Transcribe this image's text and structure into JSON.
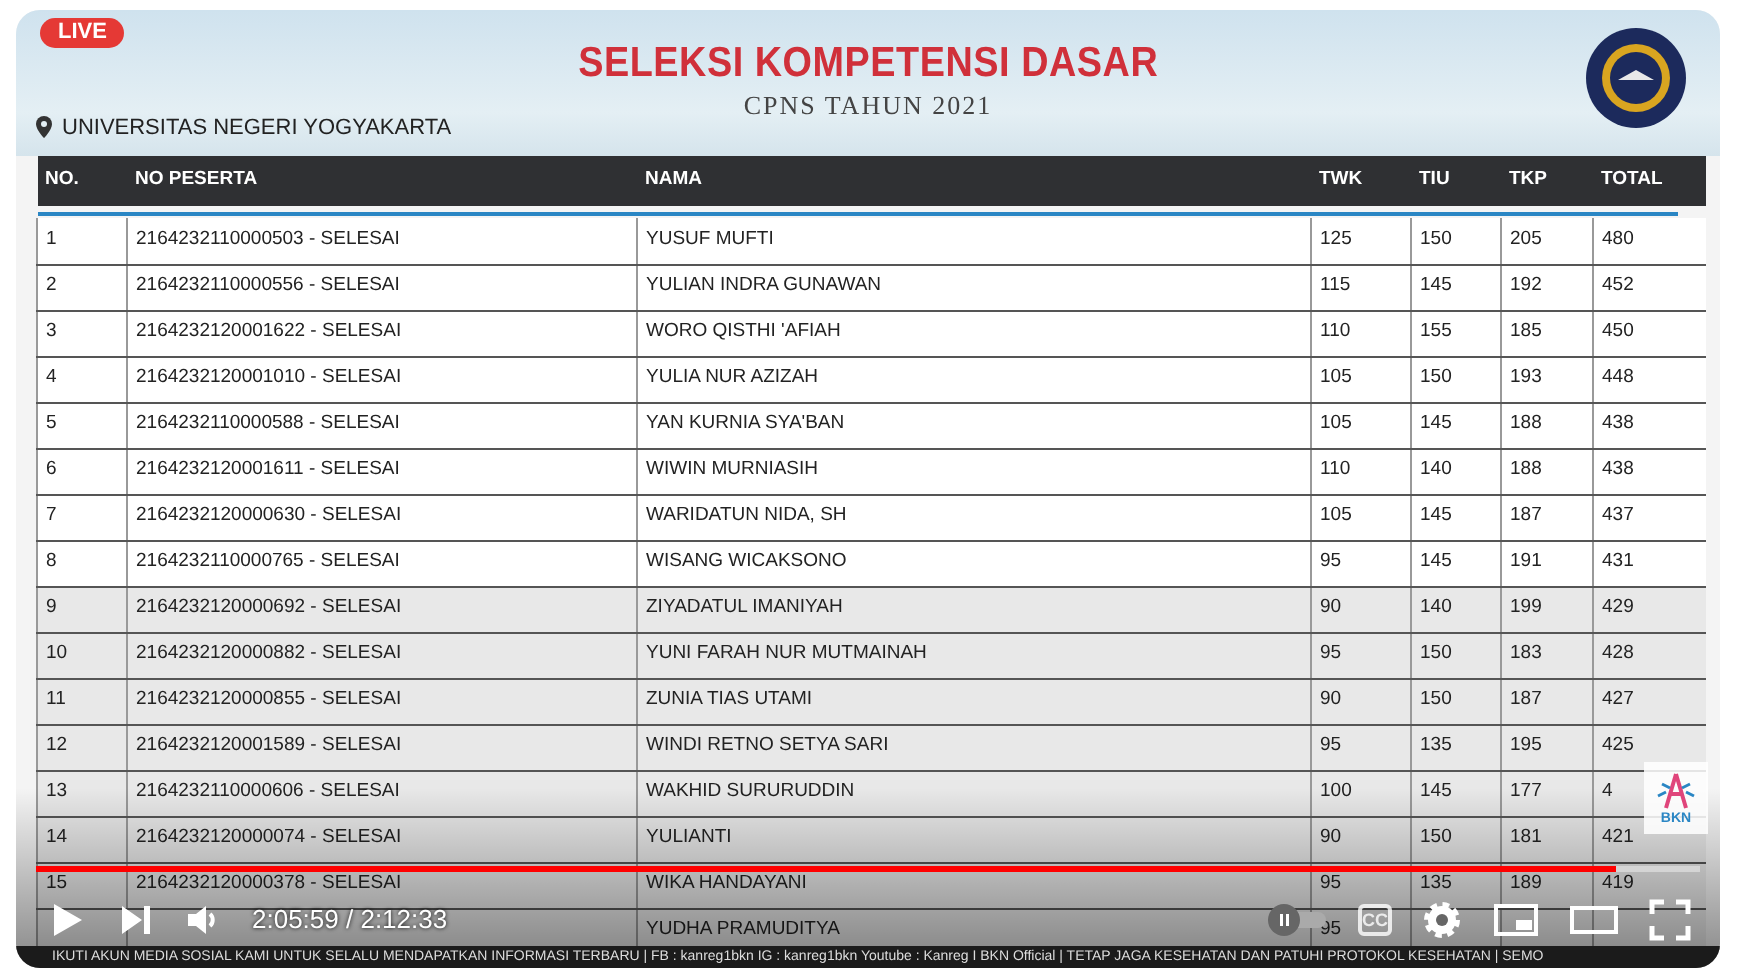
{
  "live_badge": "LIVE",
  "header": {
    "title": "SELEKSI KOMPETENSI DASAR",
    "subtitle": "CPNS TAHUN 2021",
    "location": "UNIVERSITAS NEGERI YOGYAKARTA"
  },
  "table": {
    "columns": [
      "NO.",
      "NO PESERTA",
      "NAMA",
      "TWK",
      "TIU",
      "TKP",
      "TOTAL"
    ],
    "rows": [
      [
        "1",
        "2164232110000503 - SELESAI",
        "YUSUF MUFTI",
        "125",
        "150",
        "205",
        "480"
      ],
      [
        "2",
        "2164232110000556 - SELESAI",
        "YULIAN INDRA GUNAWAN",
        "115",
        "145",
        "192",
        "452"
      ],
      [
        "3",
        "2164232120001622 - SELESAI",
        "WORO QISTHI 'AFIAH",
        "110",
        "155",
        "185",
        "450"
      ],
      [
        "4",
        "2164232120001010 - SELESAI",
        "YULIA NUR AZIZAH",
        "105",
        "150",
        "193",
        "448"
      ],
      [
        "5",
        "2164232110000588 - SELESAI",
        "YAN KURNIA SYA'BAN",
        "105",
        "145",
        "188",
        "438"
      ],
      [
        "6",
        "2164232120001611 - SELESAI",
        "WIWIN MURNIASIH",
        "110",
        "140",
        "188",
        "438"
      ],
      [
        "7",
        "2164232120000630 - SELESAI",
        "WARIDATUN NIDA, SH",
        "105",
        "145",
        "187",
        "437"
      ],
      [
        "8",
        "2164232110000765 - SELESAI",
        "WISANG WICAKSONO",
        "95",
        "145",
        "191",
        "431"
      ],
      [
        "9",
        "2164232120000692 - SELESAI",
        "ZIYADATUL IMANIYAH",
        "90",
        "140",
        "199",
        "429"
      ],
      [
        "10",
        "2164232120000882 - SELESAI",
        "YUNI FARAH NUR MUTMAINAH",
        "95",
        "150",
        "183",
        "428"
      ],
      [
        "11",
        "2164232120000855 - SELESAI",
        "ZUNIA TIAS UTAMI",
        "90",
        "150",
        "187",
        "427"
      ],
      [
        "12",
        "2164232120001589 - SELESAI",
        "WINDI RETNO SETYA SARI",
        "95",
        "135",
        "195",
        "425"
      ],
      [
        "13",
        "2164232110000606 - SELESAI",
        "WAKHID SURURUDDIN",
        "100",
        "145",
        "177",
        "4"
      ],
      [
        "14",
        "2164232120000074 - SELESAI",
        "YULIANTI",
        "90",
        "150",
        "181",
        "421"
      ],
      [
        "15",
        "2164232120000378 - SELESAI",
        "WIKA HANDAYANI",
        "95",
        "135",
        "189",
        "419"
      ],
      [
        "",
        "",
        "YUDHA PRAMUDITYA",
        "95",
        "",
        "",
        ""
      ]
    ]
  },
  "player": {
    "progress": {
      "level": 0.95
    },
    "time": "2:05:59 / 2:12:33",
    "autoplay": {
      "on": false
    },
    "cc": "CC"
  },
  "ticker": "IKUTI AKUN MEDIA SOSIAL KAMI UNTUK SELALU MENDAPATKAN INFORMASI TERBARU  |  FB : kanreg1bkn  IG : kanreg1bkn  Youtube : Kanreg I BKN Official  |  TETAP JAGA KESEHATAN DAN PATUHI PROTOKOL KESEHATAN  |  SEMO",
  "logo_text": "BKN"
}
